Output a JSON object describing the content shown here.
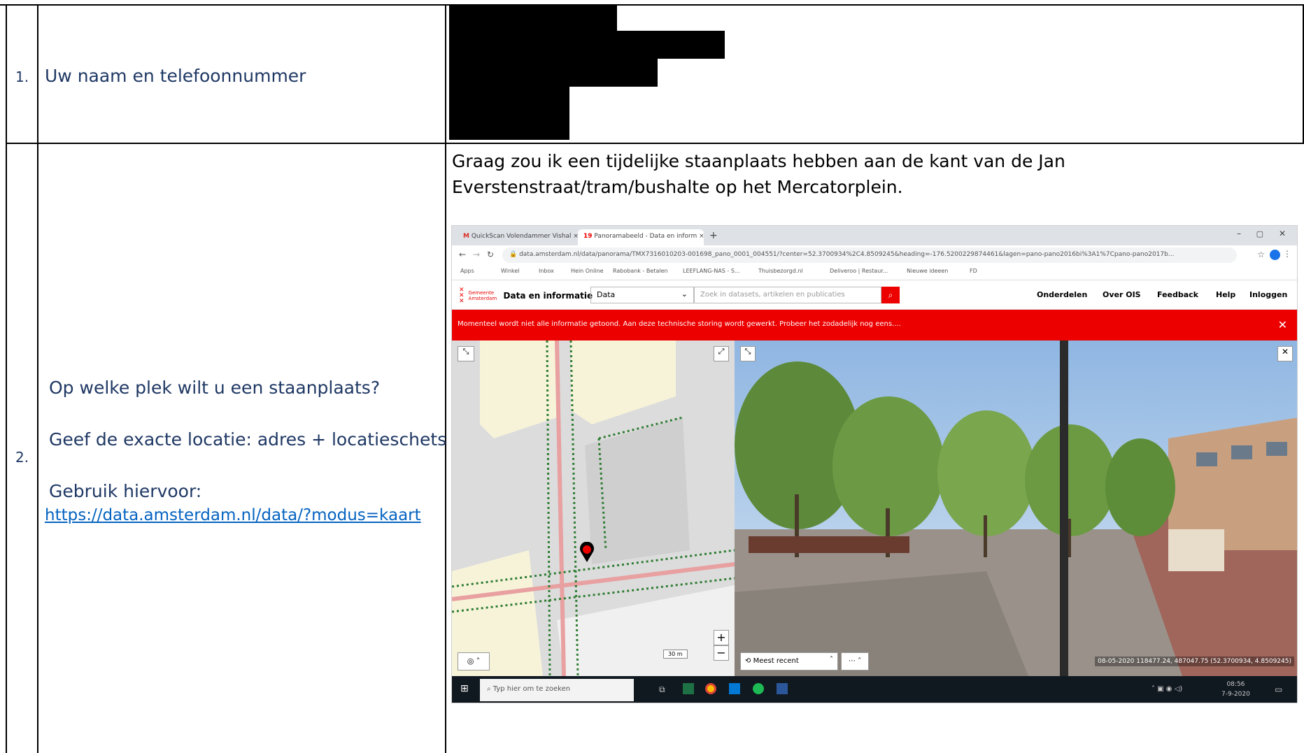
{
  "rows": [
    {
      "number": "1.",
      "question": "Uw naam en telefoonnummer"
    },
    {
      "number": "2.",
      "question_lines": [
        "Op welke plek wilt u een staanplaats?",
        "Geef de exacte locatie: adres + locatieschets",
        "Gebruik hiervoor:"
      ],
      "link": "https://data.amsterdam.nl/data/?modus=kaart",
      "answer": "Graag zou ik een tijdelijke staanplaats hebben aan de kant van de Jan Everstenstraat/tram/bushalte op het Mercatorplein."
    }
  ],
  "screenshot": {
    "tabs": [
      "QuickScan Volendammer Vishal",
      "Panoramabeeld - Data en inform"
    ],
    "url": "data.amsterdam.nl/data/panorama/TMX7316010203-001698_pano_0001_004551/?center=52.3700934%2C4.8509245&heading=-176.5200229874461&lagen=pano-pano2016bi%3A1%7Cpano-pano2017b...",
    "bookmarks": [
      "Apps",
      "Winkel",
      "Inbox",
      "Hein Online",
      "Rabobank - Betalen",
      "LEEFLANG-NAS - S...",
      "Thuisbezorgd.nl",
      "Deliveroo | Restaur...",
      "Nieuwe ideeen",
      "FD"
    ],
    "site_title": "Data en informatie",
    "logo_text": "Gemeente Amsterdam",
    "search_category": "Data",
    "search_placeholder": "Zoek in datasets, artikelen en publicaties",
    "nav": [
      "Onderdelen",
      "Over OIS",
      "Feedback",
      "Help",
      "Inloggen"
    ],
    "banner": "Momenteel wordt niet alle informatie getoond. Aan deze technische storing wordt gewerkt. Probeer het zodadelijk nog eens....",
    "map_scale": "30 m",
    "pano_select": "Meest recent",
    "pano_info": "08-05-2020   118477.24, 487047.75 (52.3700934, 4.8509245)",
    "taskbar_search": "Typ hier om te zoeken",
    "clock_time": "08:56",
    "clock_date": "7-9-2020",
    "colors": {
      "accent": "#ec0000",
      "link": "#0563c1",
      "question": "#1f3864"
    }
  }
}
